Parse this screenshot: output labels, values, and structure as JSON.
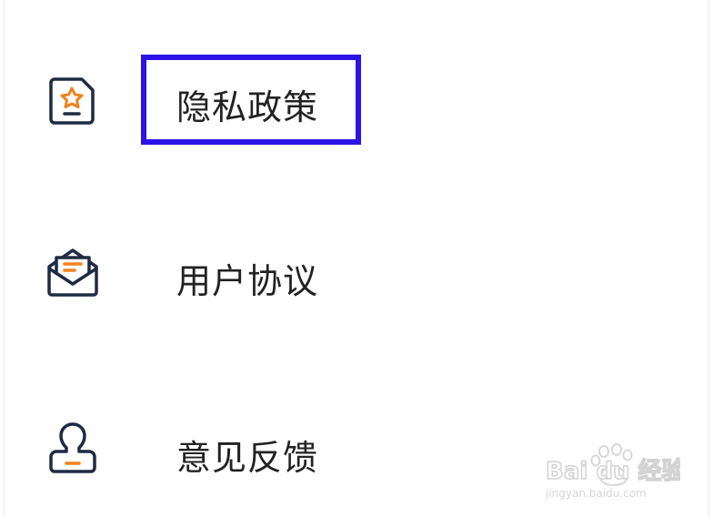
{
  "menu": {
    "items": [
      {
        "label": "隐私政策",
        "icon": "privacy-document-star-icon"
      },
      {
        "label": "用户协议",
        "icon": "envelope-letter-icon"
      },
      {
        "label": "意见反馈",
        "icon": "person-feedback-icon"
      }
    ]
  },
  "colors": {
    "icon_stroke": "#1f2a44",
    "icon_accent": "#f0821e",
    "highlight_border": "#2d14e6",
    "text": "#222222"
  },
  "watermark": {
    "brand": "Bai du 经验",
    "url": "jingyan.baidu.com"
  }
}
